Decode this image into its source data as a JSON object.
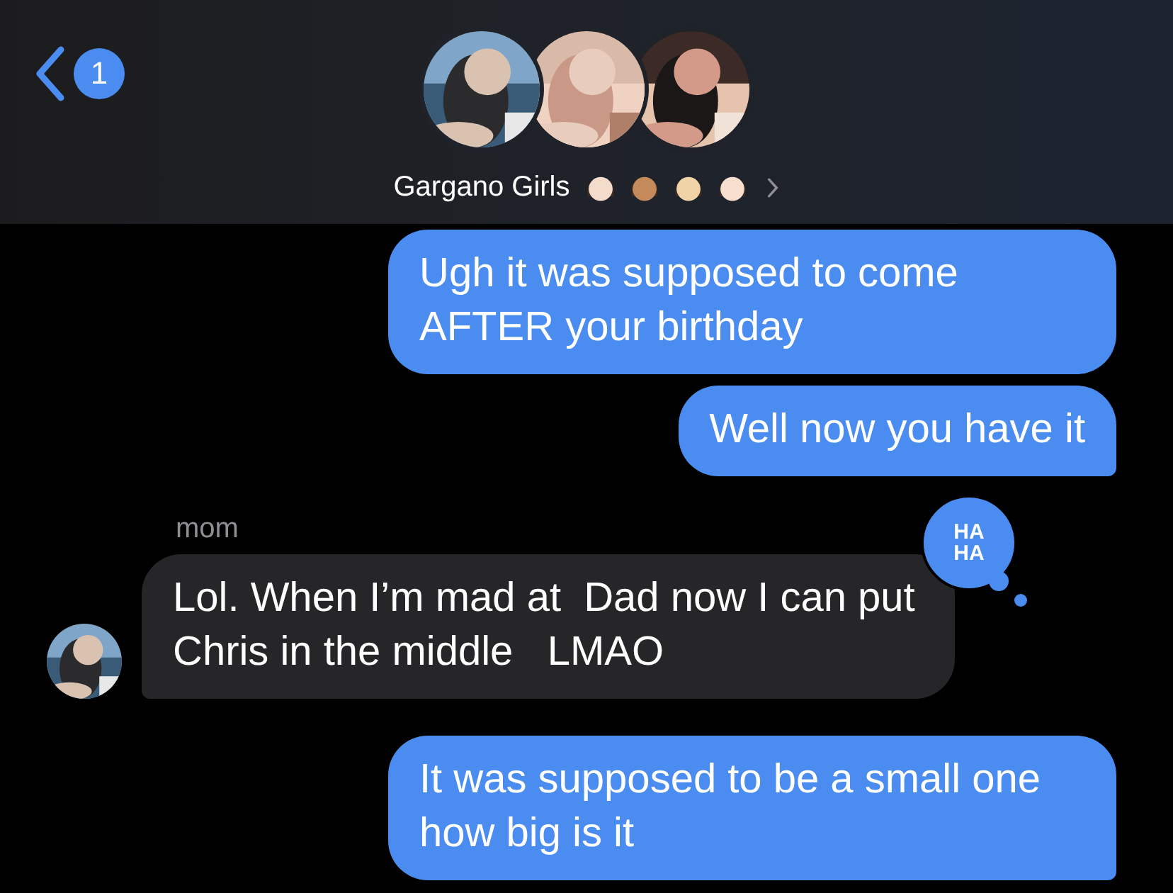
{
  "header": {
    "back_badge": "1",
    "title": "Gargano Girls",
    "title_emojis": [
      {
        "color": "#f4dccb"
      },
      {
        "color": "#c48a5c"
      },
      {
        "color": "#f1d3a8"
      },
      {
        "color": "#f6dfcf"
      }
    ]
  },
  "messages": [
    {
      "kind": "outgoing",
      "text": "Ugh it was supposed to come AFTER your birthday",
      "tail": false
    },
    {
      "kind": "outgoing",
      "text": "Well now you have it",
      "tail": true
    },
    {
      "kind": "incoming",
      "sender": "mom",
      "text": "Lol. When I’m mad at  Dad now I can put Chris in the middle   LMAO",
      "tapback": "HA HA",
      "tail": true
    },
    {
      "kind": "outgoing",
      "text": "It was supposed to be a small one how big is it",
      "tail": true
    }
  ]
}
